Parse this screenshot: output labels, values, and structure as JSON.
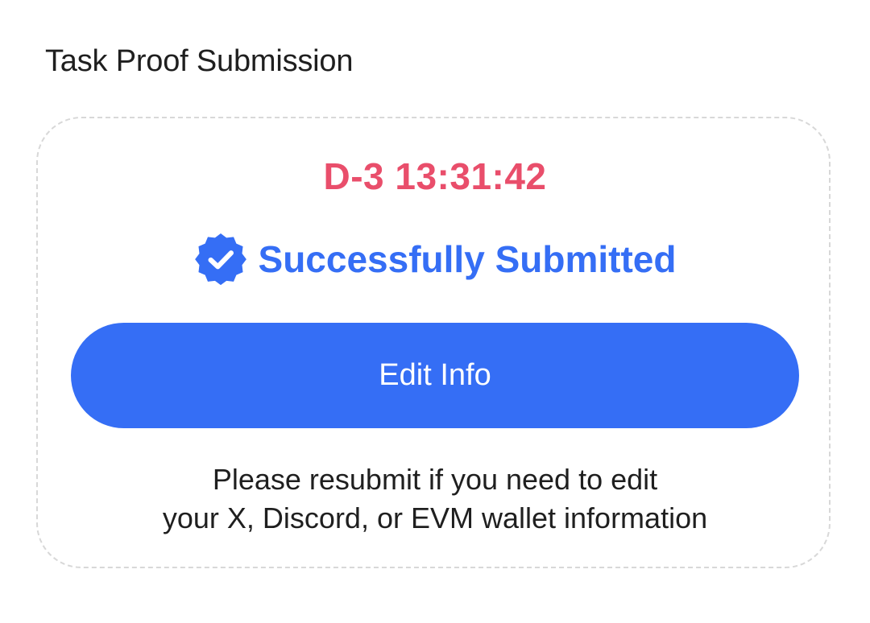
{
  "section": {
    "title": "Task Proof Submission"
  },
  "card": {
    "countdown": "D-3 13:31:42",
    "status": {
      "icon": "verified-badge-icon",
      "label": "Successfully Submitted"
    },
    "edit_button_label": "Edit Info",
    "help_line_1": "Please resubmit if you need to edit",
    "help_line_2": "your X, Discord, or EVM wallet information"
  },
  "colors": {
    "countdown": "#e94e6b",
    "accent": "#356ef5",
    "border": "#d8d8d8"
  }
}
